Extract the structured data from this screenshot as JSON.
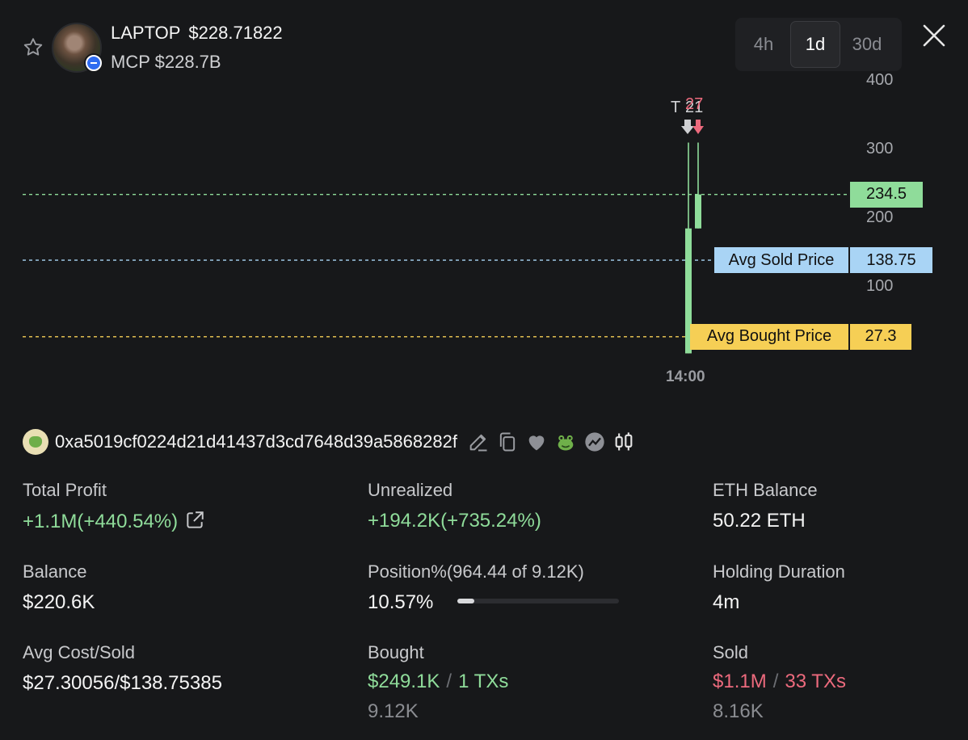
{
  "header": {
    "token_symbol": "LAPTOP",
    "token_price": "$228.71822",
    "mcp_label": "MCP",
    "mcp_value": "$228.7B",
    "timeframes": [
      "4h",
      "1d",
      "30d"
    ],
    "active_timeframe": "1d",
    "icons": {
      "favorite": "star-icon",
      "close": "close-icon"
    }
  },
  "chart_data": {
    "type": "candlestick",
    "y_ticks": [
      "400",
      "300",
      "200",
      "100"
    ],
    "x_ticks": [
      "14:00"
    ],
    "ylim": [
      0,
      400
    ],
    "candles": [
      {
        "open": 3,
        "close": 185,
        "high": 310,
        "low": 3,
        "color": "#8fdc9a"
      },
      {
        "open": 185,
        "close": 234.5,
        "high": 310,
        "low": 185,
        "color": "#8fdc9a"
      }
    ],
    "markers": [
      {
        "label": "T",
        "color": "#cfd0d3"
      },
      {
        "label": "21",
        "color": "#cfd0d3"
      },
      {
        "label": "27",
        "color": "#ec6a7d"
      }
    ],
    "levels": [
      {
        "name": "current",
        "value": 234.5,
        "label": "",
        "value_label": "234.5",
        "color": "#8fdc9a"
      },
      {
        "name": "avg_sold",
        "value": 138.75,
        "label": "Avg Sold Price",
        "value_label": "138.75",
        "color": "#a9d4f5"
      },
      {
        "name": "avg_bought",
        "value": 27.3,
        "label": "Avg Bought Price",
        "value_label": "27.3",
        "color": "#f6cf55"
      }
    ]
  },
  "wallet": {
    "address": "0xa5019cf0224d21d41437d3cd7648d39a5868282f",
    "icons": [
      "edit-icon",
      "copy-icon",
      "heart-icon",
      "frog-icon",
      "chart-circle-icon",
      "candlestick-icon"
    ]
  },
  "stats": {
    "total_profit": {
      "label": "Total Profit",
      "value": "+1.1M(+440.54%)"
    },
    "unrealized": {
      "label": "Unrealized",
      "value": "+194.2K(+735.24%)"
    },
    "eth_balance": {
      "label": "ETH Balance",
      "value": "50.22 ETH"
    },
    "balance": {
      "label": "Balance",
      "value": "$220.6K"
    },
    "position": {
      "label": "Position%(964.44 of 9.12K)",
      "value": "10.57%",
      "fraction": 0.1057
    },
    "holding": {
      "label": "Holding Duration",
      "value": "4m"
    },
    "avg_cost": {
      "label": "Avg Cost/Sold",
      "value": "$27.30056/$138.75385"
    },
    "bought": {
      "label": "Bought",
      "amount": "$249.1K",
      "separator": "/",
      "txs": "1 TXs",
      "tokens": "9.12K"
    },
    "sold": {
      "label": "Sold",
      "amount": "$1.1M",
      "separator": "/",
      "txs": "33 TXs",
      "tokens": "8.16K"
    }
  }
}
